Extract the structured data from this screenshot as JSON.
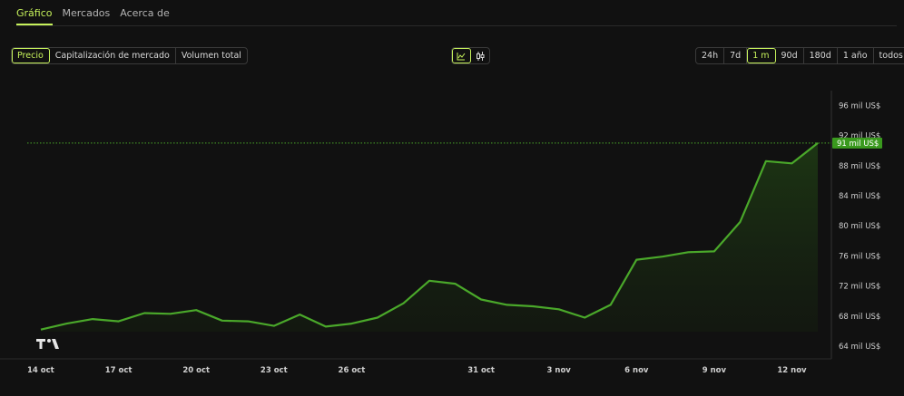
{
  "tabs": [
    {
      "label": "Gráfico",
      "active": true
    },
    {
      "label": "Mercados",
      "active": false
    },
    {
      "label": "Acerca de",
      "active": false
    }
  ],
  "metric_options": [
    {
      "label": "Precio",
      "active": true
    },
    {
      "label": "Capitalización de mercado",
      "active": false
    },
    {
      "label": "Volumen total",
      "active": false
    }
  ],
  "chart_types": [
    {
      "icon": "line-chart-icon",
      "active": true
    },
    {
      "icon": "candlestick-icon",
      "active": false
    }
  ],
  "ranges": [
    {
      "label": "24h",
      "active": false
    },
    {
      "label": "7d",
      "active": false
    },
    {
      "label": "1 m",
      "active": true
    },
    {
      "label": "90d",
      "active": false
    },
    {
      "label": "180d",
      "active": false
    },
    {
      "label": "1 año",
      "active": false
    },
    {
      "label": "todos",
      "active": false
    }
  ],
  "colors": {
    "accent": "#c6f25b",
    "line": "#4aa82a",
    "price_tag": "#3a9a1e"
  },
  "chart_data": {
    "type": "area",
    "x": [
      "14 oct",
      "15 oct",
      "16 oct",
      "17 oct",
      "18 oct",
      "19 oct",
      "20 oct",
      "21 oct",
      "22 oct",
      "23 oct",
      "24 oct",
      "25 oct",
      "26 oct",
      "27 oct",
      "28 oct",
      "29 oct",
      "30 oct",
      "31 oct",
      "1 nov",
      "2 nov",
      "3 nov",
      "4 nov",
      "5 nov",
      "6 nov",
      "7 nov",
      "8 nov",
      "9 nov",
      "10 nov",
      "11 nov",
      "12 nov",
      "13 nov"
    ],
    "values": [
      66.2,
      67.0,
      67.6,
      67.3,
      68.4,
      68.3,
      68.8,
      67.4,
      67.3,
      66.7,
      68.2,
      66.6,
      67.0,
      67.8,
      69.7,
      72.7,
      72.3,
      70.2,
      69.5,
      69.3,
      68.9,
      67.8,
      69.5,
      75.5,
      75.9,
      76.5,
      76.6,
      80.5,
      88.6,
      88.3,
      91.0
    ],
    "y_ticks": [
      64,
      68,
      72,
      76,
      80,
      84,
      88,
      92,
      96
    ],
    "y_tick_labels": [
      "64 mil US$",
      "68 mil US$",
      "72 mil US$",
      "76 mil US$",
      "80 mil US$",
      "84 mil US$",
      "88 mil US$",
      "92 mil US$",
      "96 mil US$"
    ],
    "x_ticks": [
      {
        "index": 0,
        "label": "14 oct"
      },
      {
        "index": 3,
        "label": "17 oct"
      },
      {
        "index": 6,
        "label": "20 oct"
      },
      {
        "index": 9,
        "label": "23 oct"
      },
      {
        "index": 12,
        "label": "26 oct"
      },
      {
        "index": 17,
        "label": "31 oct"
      },
      {
        "index": 20,
        "label": "3 nov"
      },
      {
        "index": 23,
        "label": "6 nov"
      },
      {
        "index": 26,
        "label": "9 nov"
      },
      {
        "index": 29,
        "label": "12 nov"
      }
    ],
    "current_price": 91,
    "current_price_label": "91 mil US$",
    "ylim": [
      62,
      99
    ],
    "grid": false
  }
}
